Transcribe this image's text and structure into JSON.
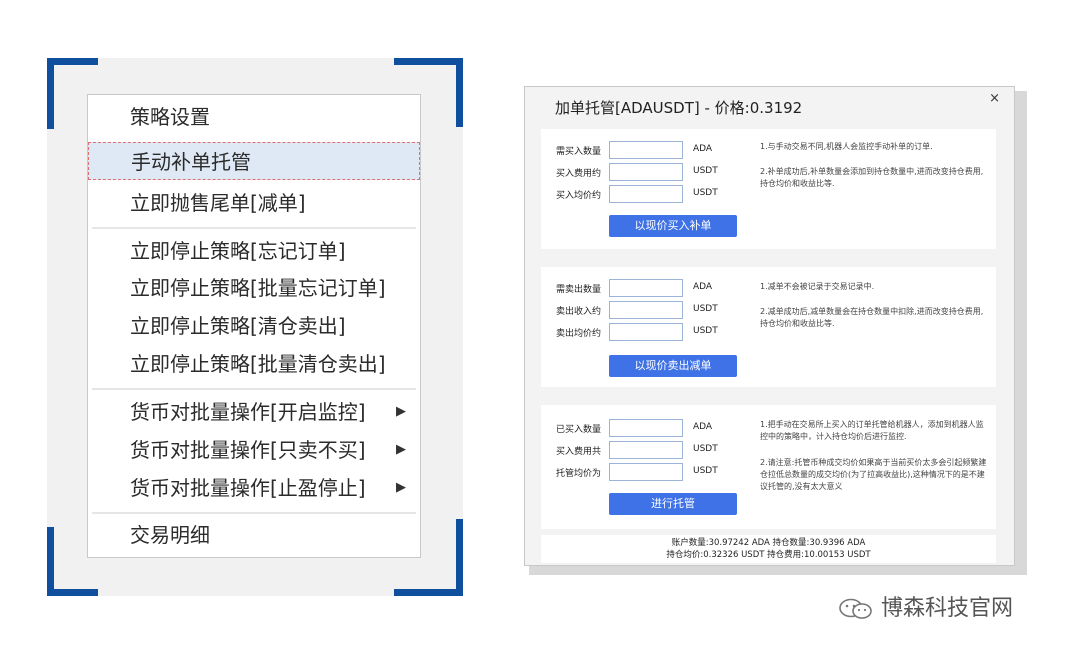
{
  "menu": {
    "items": [
      {
        "label": "策略设置",
        "arrow": ""
      },
      {
        "label": "手动补单托管",
        "arrow": ""
      },
      {
        "label": "立即抛售尾单[减单]",
        "arrow": ""
      },
      {
        "label": "立即停止策略[忘记订单]",
        "arrow": ""
      },
      {
        "label": "立即停止策略[批量忘记订单]",
        "arrow": ""
      },
      {
        "label": "立即停止策略[清仓卖出]",
        "arrow": ""
      },
      {
        "label": "立即停止策略[批量清仓卖出]",
        "arrow": ""
      },
      {
        "label": "货币对批量操作[开启监控]",
        "arrow": "▶"
      },
      {
        "label": "货币对批量操作[只卖不买]",
        "arrow": "▶"
      },
      {
        "label": "货币对批量操作[止盈停止]",
        "arrow": "▶"
      },
      {
        "label": "交易明细",
        "arrow": ""
      }
    ]
  },
  "dialog": {
    "title": "加单托管[ADAUSDT] - 价格:0.3192",
    "close": "×",
    "buy": {
      "rows": [
        {
          "label": "需买入数量",
          "unit": "ADA",
          "value": ""
        },
        {
          "label": "买入费用约",
          "unit": "USDT",
          "value": ""
        },
        {
          "label": "买入均价约",
          "unit": "USDT",
          "value": ""
        }
      ],
      "note1": "1.与手动交易不同,机器人会监控手动补单的订单.",
      "note2": "2.补单成功后,补单数量会添加到持仓数量中,进而改变持仓费用,持仓均价和收益比等.",
      "button": "以现价买入补单"
    },
    "sell": {
      "rows": [
        {
          "label": "需卖出数量",
          "unit": "ADA",
          "value": ""
        },
        {
          "label": "卖出收入约",
          "unit": "USDT",
          "value": ""
        },
        {
          "label": "卖出均价约",
          "unit": "USDT",
          "value": ""
        }
      ],
      "note1": "1.减单不会被记录于交易记录中.",
      "note2": "2.减单成功后,减单数量会在持仓数量中扣除,进而改变持仓费用,持仓均价和收益比等.",
      "button": "以现价卖出减单"
    },
    "host": {
      "rows": [
        {
          "label": "已买入数量",
          "unit": "ADA",
          "value": ""
        },
        {
          "label": "买入费用共",
          "unit": "USDT",
          "value": ""
        },
        {
          "label": "托管均价为",
          "unit": "USDT",
          "value": ""
        }
      ],
      "note1": "1.把手动在交易所上买入的订单托管给机器人，添加到机器人监控中的策略中，计入持仓均价后进行监控.",
      "note2": "2.请注意:托管币种成交均价如果高于当前买价太多会引起频繁建仓拉低总数量的成交均价(为了拉高收益比),这种情况下的是不建议托管的,没有太大意义",
      "button": "进行托管"
    },
    "footer": {
      "line1": "账户数量:30.97242 ADA    持仓数量:30.9396 ADA",
      "line2": "持仓均价:0.32326 USDT    持仓费用:10.00153 USDT"
    }
  },
  "watermark": {
    "text": "博森科技官网",
    "icon": "wechat-icon"
  }
}
